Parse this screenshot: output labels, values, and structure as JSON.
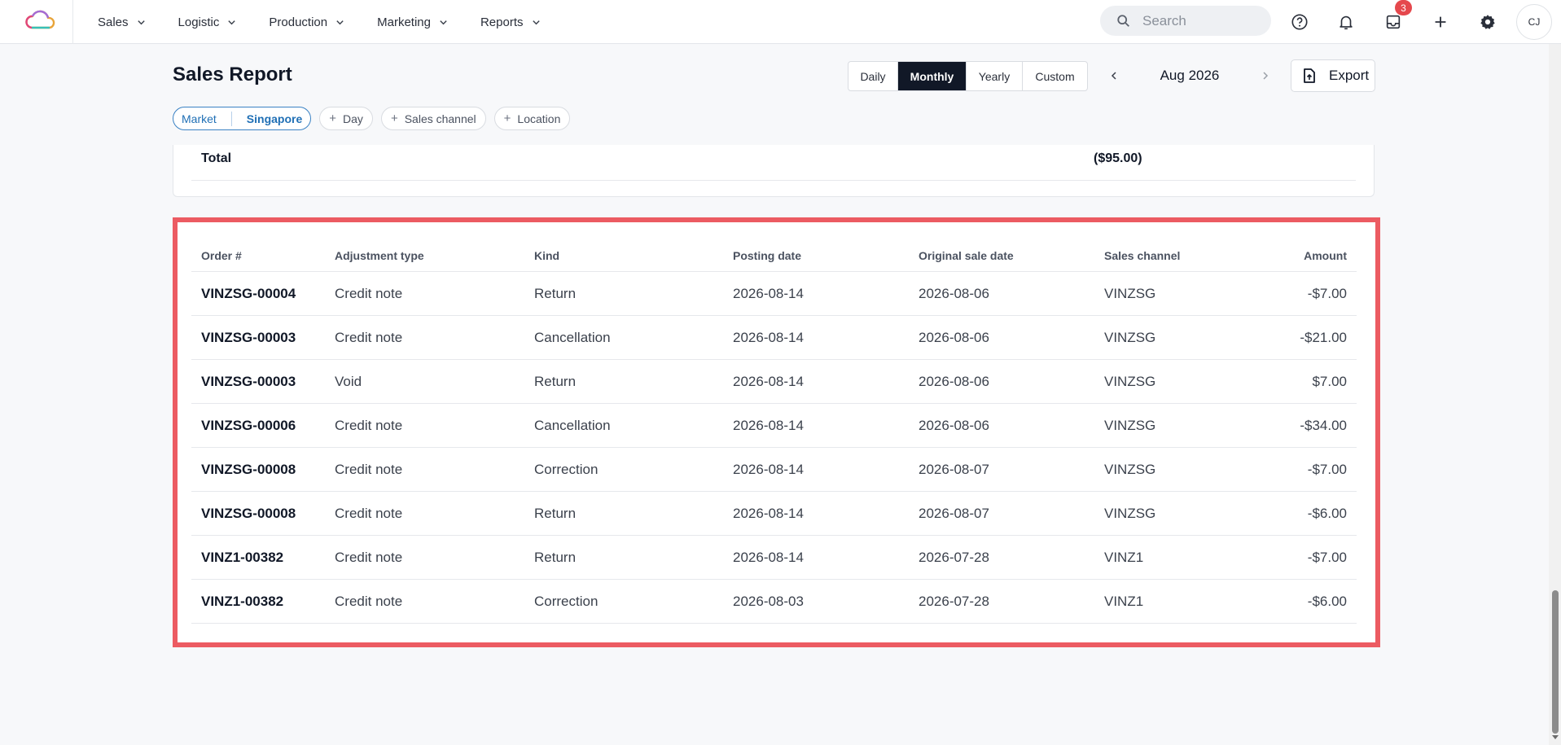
{
  "nav": {
    "menu": [
      {
        "label": "Sales"
      },
      {
        "label": "Logistic"
      },
      {
        "label": "Production"
      },
      {
        "label": "Marketing"
      },
      {
        "label": "Reports"
      }
    ],
    "search_placeholder": "Search",
    "inbox_badge": "3",
    "avatar_initials": "CJ",
    "icons": [
      "help-icon",
      "bell-icon",
      "inbox-icon",
      "plus-icon",
      "gear-icon"
    ]
  },
  "report": {
    "title": "Sales Report",
    "views": [
      "Daily",
      "Monthly",
      "Yearly",
      "Custom"
    ],
    "active_view": "Monthly",
    "period": "Aug 2026",
    "export_label": "Export",
    "filters": {
      "market_label": "Market",
      "market_value": "Singapore",
      "add_filters": [
        "Day",
        "Sales channel",
        "Location"
      ]
    }
  },
  "total": {
    "label": "Total",
    "value": "($95.00)"
  },
  "adjustments": {
    "columns": [
      "Order #",
      "Adjustment type",
      "Kind",
      "Posting date",
      "Original sale date",
      "Sales channel",
      "Amount"
    ],
    "rows": [
      [
        "VINZSG-00004",
        "Credit note",
        "Return",
        "2026-08-14",
        "2026-08-06",
        "VINZSG",
        "-$7.00"
      ],
      [
        "VINZSG-00003",
        "Credit note",
        "Cancellation",
        "2026-08-14",
        "2026-08-06",
        "VINZSG",
        "-$21.00"
      ],
      [
        "VINZSG-00003",
        "Void",
        "Return",
        "2026-08-14",
        "2026-08-06",
        "VINZSG",
        "$7.00"
      ],
      [
        "VINZSG-00006",
        "Credit note",
        "Cancellation",
        "2026-08-14",
        "2026-08-06",
        "VINZSG",
        "-$34.00"
      ],
      [
        "VINZSG-00008",
        "Credit note",
        "Correction",
        "2026-08-14",
        "2026-08-07",
        "VINZSG",
        "-$7.00"
      ],
      [
        "VINZSG-00008",
        "Credit note",
        "Return",
        "2026-08-14",
        "2026-08-07",
        "VINZSG",
        "-$6.00"
      ],
      [
        "VINZ1-00382",
        "Credit note",
        "Return",
        "2026-08-14",
        "2026-07-28",
        "VINZ1",
        "-$7.00"
      ],
      [
        "VINZ1-00382",
        "Credit note",
        "Correction",
        "2026-08-03",
        "2026-07-28",
        "VINZ1",
        "-$6.00"
      ]
    ]
  },
  "colors": {
    "highlight_border": "#ec5b62",
    "active_segment": "#111827",
    "market_chip": "#3b82c4",
    "badge": "#e5484d"
  }
}
